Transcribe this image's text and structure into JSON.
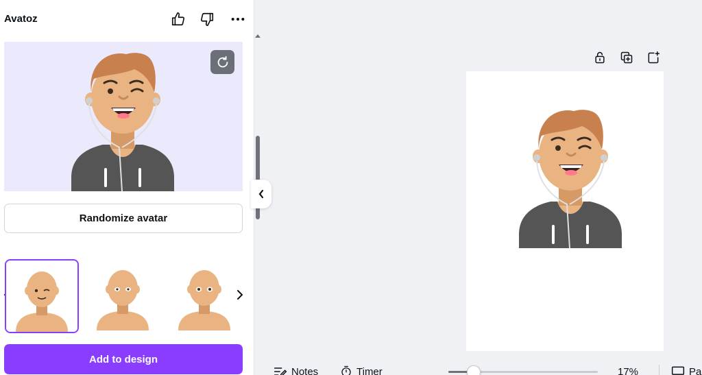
{
  "app": {
    "title": "Avatoz"
  },
  "header_icons": [
    "thumbs-up-icon",
    "thumbs-down-icon",
    "more-icon"
  ],
  "preview": {
    "background": "#ebeafd",
    "refresh_icon": "refresh-icon"
  },
  "randomize_button": {
    "label": "Randomize avatar"
  },
  "carousel": {
    "prev_icon": "chevron-left-icon",
    "next_icon": "chevron-right-icon",
    "items": [
      {
        "expression": "wink",
        "selected": true
      },
      {
        "expression": "neutral",
        "selected": false
      },
      {
        "expression": "neutral",
        "selected": false
      }
    ]
  },
  "add_button": {
    "label": "Add to design",
    "color": "#8b3dff"
  },
  "page_toolbar": [
    "lock-icon",
    "duplicate-icon",
    "add-page-icon"
  ],
  "bottom_bar": {
    "notes_label": "Notes",
    "timer_label": "Timer",
    "zoom": "17%",
    "zoom_fraction": 0.17,
    "pages_label": "Pa"
  },
  "colors": {
    "accent": "#8b3dff",
    "hair": "#c8804f",
    "skin": "#e9b482",
    "hoodie": "#555555"
  }
}
